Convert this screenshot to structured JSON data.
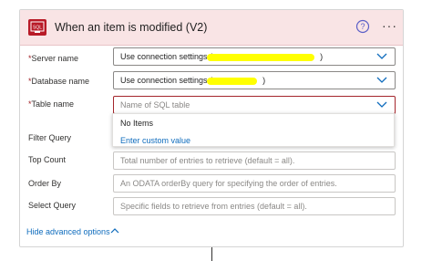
{
  "header": {
    "title": "When an item is modified (V2)",
    "icon": "sql-server-icon",
    "icon_text": "SQL",
    "help_icon": "help-icon",
    "more_label": "···",
    "accent": "#b81a27"
  },
  "fields": {
    "server": {
      "label": "Server name",
      "required": "*",
      "value": "Use connection settings (",
      "value_suffix": ")"
    },
    "database": {
      "label": "Database name",
      "required": "*",
      "value": "Use connection settings (",
      "value_suffix": ")"
    },
    "table": {
      "label": "Table name",
      "required": "*",
      "placeholder": "Name of SQL table"
    },
    "filter": {
      "label": "Filter Query"
    },
    "top": {
      "label": "Top Count",
      "placeholder": "Total number of entries to retrieve (default = all)."
    },
    "order": {
      "label": "Order By",
      "placeholder": "An ODATA orderBy query for specifying the order of entries."
    },
    "select": {
      "label": "Select Query",
      "placeholder": "Specific fields to retrieve from entries (default = all)."
    }
  },
  "dropdown": {
    "options": [
      "No Items",
      "Enter custom value"
    ]
  },
  "advanced": {
    "label": "Hide advanced options"
  }
}
